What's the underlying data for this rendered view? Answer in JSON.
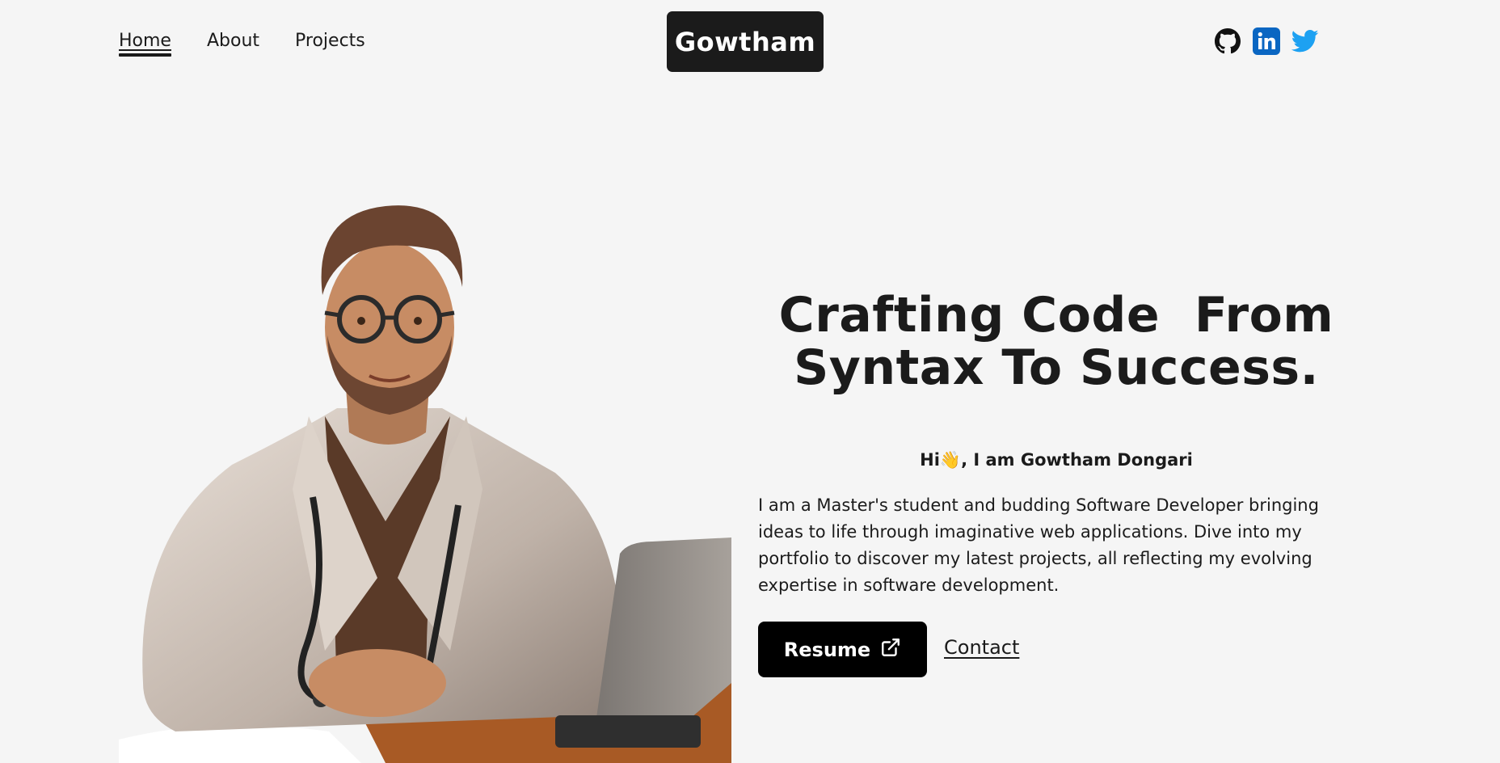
{
  "nav": {
    "items": [
      {
        "label": "Home",
        "active": true
      },
      {
        "label": "About",
        "active": false
      },
      {
        "label": "Projects",
        "active": false
      }
    ]
  },
  "brand": {
    "name": "Gowtham"
  },
  "socials": [
    {
      "icon": "github-icon",
      "color": "#111111"
    },
    {
      "icon": "linkedin-icon",
      "color": "#0a66c2"
    },
    {
      "icon": "twitter-icon",
      "color": "#1da1f2"
    }
  ],
  "hero": {
    "headline_line1": "Crafting Code  From",
    "headline_line2": "Syntax To Success.",
    "greeting_prefix": "Hi",
    "greeting_emoji": "👋",
    "greeting_suffix": ", I am Gowtham Dongari",
    "bio": "I am a Master's student and budding Software Developer bringing ideas to life through imaginative web applications. Dive into my portfolio to discover my latest projects, all reflecting my evolving expertise in software development.",
    "resume_label": "Resume",
    "contact_label": "Contact"
  },
  "colors": {
    "background": "#f5f5f5",
    "text": "#1b1b1b",
    "button": "#000000"
  }
}
